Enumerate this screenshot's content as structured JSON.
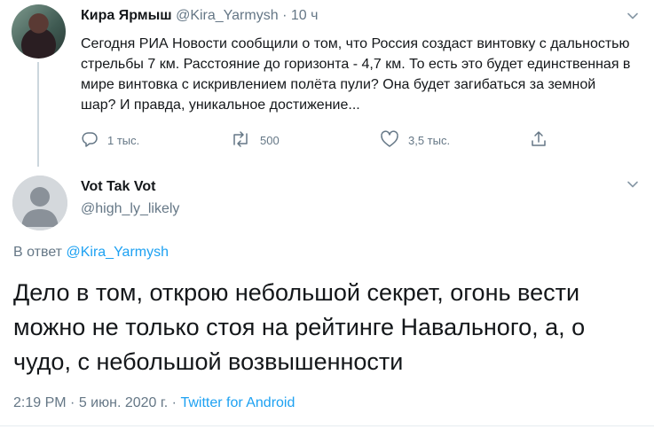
{
  "original_tweet": {
    "author_name": "Кира Ярмыш",
    "author_handle": "@Kira_Yarmysh",
    "separator": "·",
    "time": "10 ч",
    "text": "Сегодня РИА Новости сообщили о том, что Россия создаст винтовку с дальностью стрельбы 7 км. Расстояние до горизонта - 4,7 км. То есть это будет единственная в мире винтовка с искривлением полёта пули? Она будет загибаться за земной шар? И правда, уникальное достижение...",
    "actions": {
      "replies": "1 тыс.",
      "retweets": "500",
      "likes": "3,5 тыс."
    }
  },
  "reply_tweet": {
    "author_name": "Vot Tak Vot",
    "author_handle": "@high_ly_likely",
    "reply_prefix": "В ответ",
    "reply_to_handle": "@Kira_Yarmysh",
    "text": "Дело в том, открою небольшой секрет, огонь вести можно не только стоя на рейтинге Навального, а, о чудо, с небольшой возвышенности",
    "time": "2:19 PM",
    "date": "5 июн. 2020 г.",
    "dot": "·",
    "source": "Twitter for Android"
  },
  "colors": {
    "accent": "#1da1f2",
    "muted": "#657786",
    "text": "#14171a"
  },
  "icons": [
    "chevron-down-icon",
    "reply-icon",
    "retweet-icon",
    "like-icon",
    "share-icon",
    "default-avatar-icon"
  ]
}
